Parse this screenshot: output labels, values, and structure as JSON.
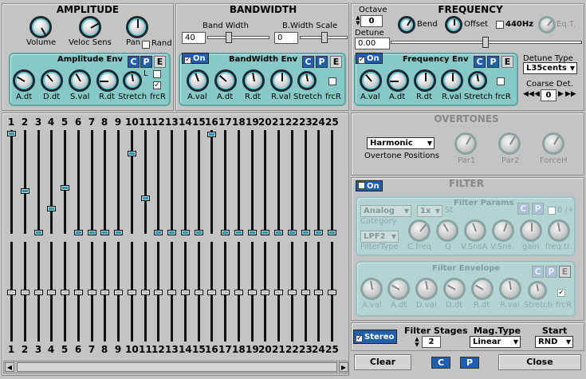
{
  "amplitude": {
    "title": "AMPLITUDE",
    "volume": "Volume",
    "veloc_sens": "Veloc Sens",
    "pan": "Pan",
    "rand": "Rand",
    "env": {
      "title": "Amplitude Env",
      "c": "C",
      "p": "P",
      "e": "E",
      "l": "L",
      "adt": "A.dt",
      "ddt": "D.dt",
      "sval": "S.val",
      "rdt": "R.dt",
      "stretch": "Stretch",
      "frcr": "frcR"
    }
  },
  "bandwidth": {
    "title": "BANDWIDTH",
    "band_width": "Band Width",
    "band_width_value": "40",
    "bw_scale": "B.Width Scale",
    "bw_scale_value": "0",
    "env": {
      "on": "On",
      "title": "BandWidth Env",
      "c": "C",
      "p": "P",
      "e": "E",
      "aval": "A.val",
      "adt": "A.dt",
      "rdt": "R.dt",
      "rval": "R.val",
      "stretch": "Stretch",
      "frcr": "frcR"
    }
  },
  "frequency": {
    "title": "FREQUENCY",
    "octave": "Octave",
    "octave_value": "0",
    "bend": "Bend",
    "offset": "Offset",
    "hz440": "440Hz",
    "eqt": "Eq.T.",
    "detune": "Detune",
    "detune_value": "0.00",
    "env": {
      "on": "On",
      "title": "Frequency Env",
      "c": "C",
      "p": "P",
      "e": "E",
      "aval": "A.val",
      "adt": "A.dt",
      "rdt": "R.dt",
      "rval": "R.val",
      "stretch": "Stretch",
      "frcr": "frcR"
    },
    "detune_type": "Detune Type",
    "detune_type_value": "L35cents",
    "coarse_det": "Coarse Det.",
    "coarse_det_value": "0"
  },
  "overtones": {
    "title": "OVERTONES",
    "harmonic": "Harmonic",
    "positions": "Overtone Positions",
    "par1": "Par1",
    "par2": "Par2",
    "forceh": "ForceH"
  },
  "filter": {
    "title": "FILTER",
    "on": "On",
    "params_title": "Filter Params",
    "category_value": "Analog",
    "category": "Category",
    "st_value": "1x",
    "st": "St",
    "c": "C",
    "p": "P",
    "plusminus": "0 /+",
    "type_value": "LPF2",
    "filtertype": "FilterType",
    "cfreq": "C.freq",
    "q": "Q",
    "vsnsa": "V.SnsA",
    "vsns": "V.Sns.",
    "gain": "gain",
    "freqtr": "freq.tr.",
    "env_title": "Filter Envelope",
    "e": "E",
    "aval": "A.val",
    "adt": "A.dt",
    "dval": "D.val",
    "ddt": "D.dt",
    "rdt": "R.dt",
    "rval": "R.val",
    "stretch": "Stretch",
    "frcr": "frcR"
  },
  "bottom": {
    "stereo": "Stereo",
    "filter_stages": "Filter Stages",
    "filter_stages_value": "2",
    "mag_type": "Mag.Type",
    "mag_type_value": "Linear",
    "start": "Start",
    "start_value": "RND",
    "clear": "Clear",
    "c": "C",
    "p": "P",
    "close": "Close"
  },
  "harmonics": {
    "numbers": [
      "1",
      "2",
      "3",
      "4",
      "5",
      "6",
      "7",
      "8",
      "9",
      "10",
      "11",
      "12",
      "13",
      "14",
      "15",
      "16",
      "17",
      "18",
      "19",
      "20",
      "21",
      "22",
      "23",
      "24",
      "25"
    ],
    "magnitudes": [
      1.0,
      0.42,
      0.0,
      0.24,
      0.45,
      0.0,
      0.0,
      0.0,
      0.0,
      0.8,
      0.35,
      0.0,
      0.0,
      0.0,
      0.0,
      0.99,
      0.0,
      0.0,
      0.0,
      0.0,
      0.0,
      0.0,
      0.0,
      0.0,
      0.0
    ]
  }
}
